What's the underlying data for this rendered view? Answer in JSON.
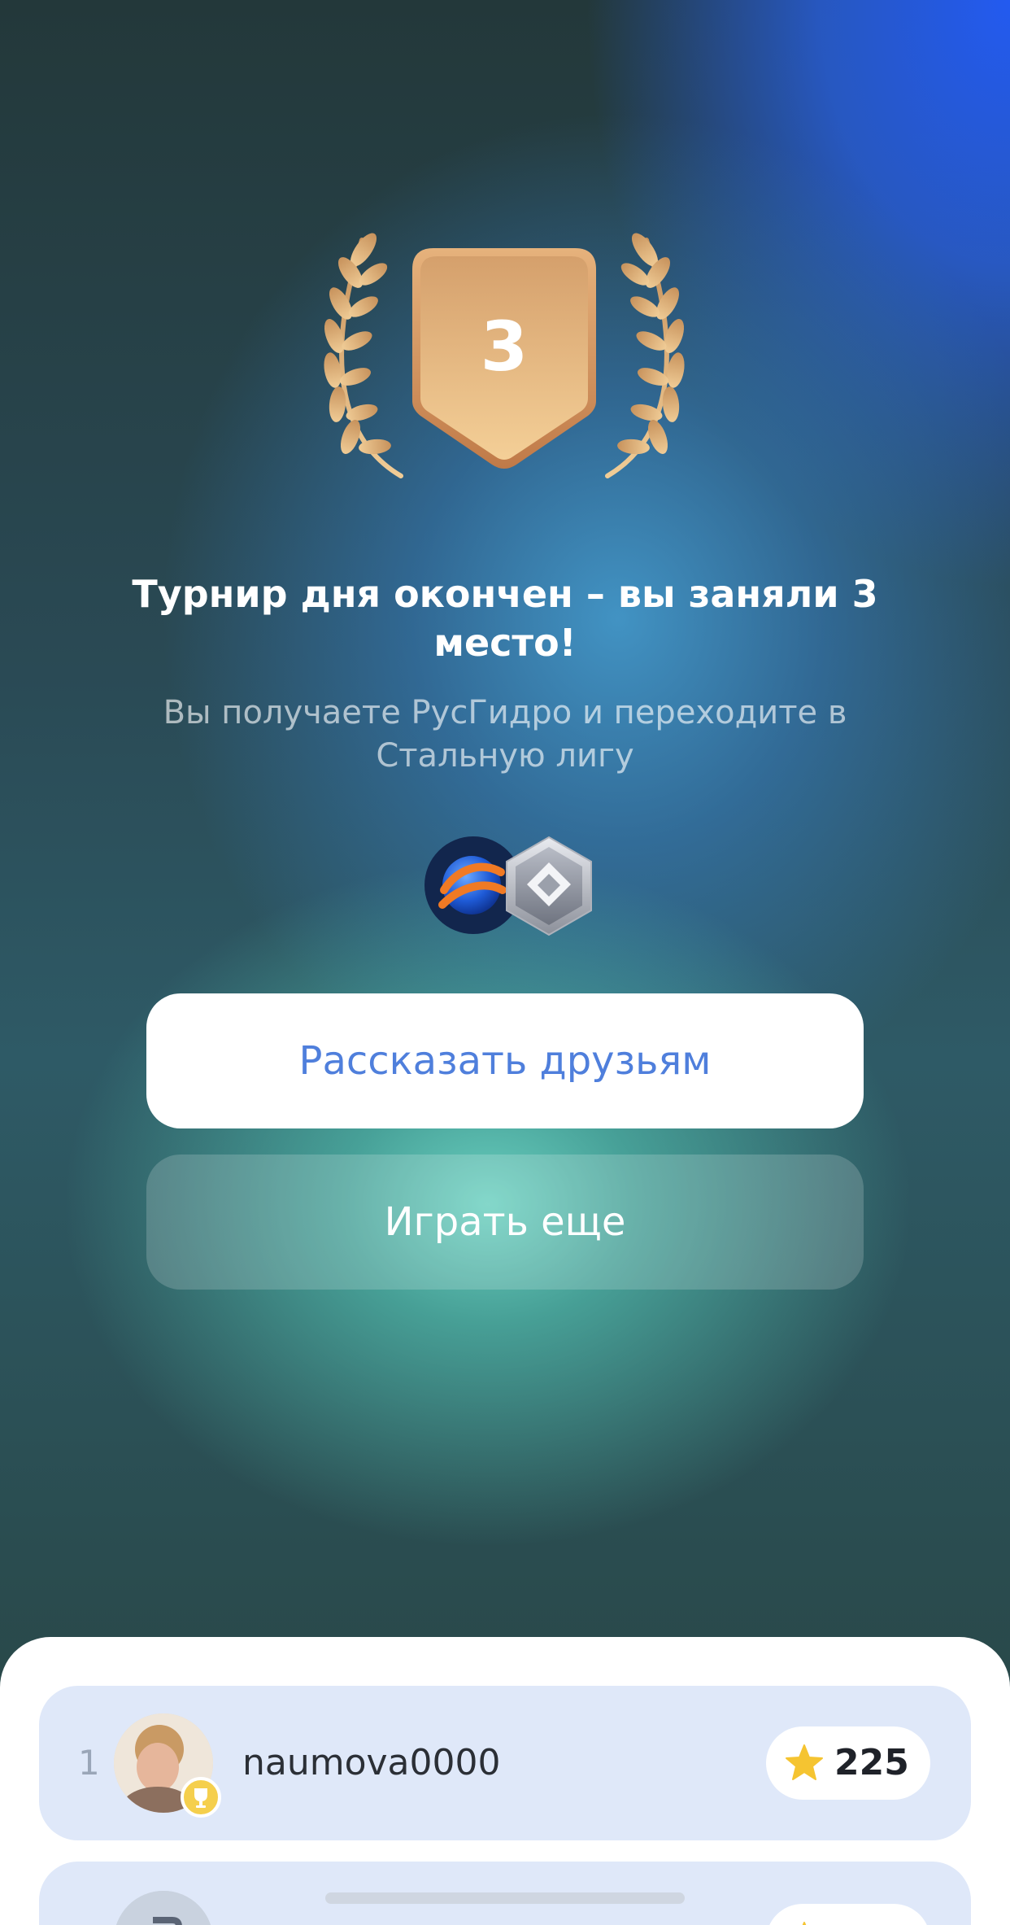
{
  "result": {
    "place_number": "3",
    "title": "Турнир дня окончен – вы заняли 3 место!",
    "subtitle": "Вы получаете РусГидро и переходите в Стальную лигу"
  },
  "rewards": {
    "brand_icon": "rushydro-logo-icon",
    "league_icon": "steel-league-icon"
  },
  "buttons": {
    "share_label": "Рассказать друзьям",
    "play_again_label": "Играть еще"
  },
  "leaderboard": {
    "rows": [
      {
        "rank": "1",
        "username": "naumova0000",
        "score": "225",
        "avatar_badge": "trophy-icon"
      }
    ]
  },
  "colors": {
    "accent_blue": "#4f7fdc",
    "bronze": "#d9a26a",
    "row_bg": "#dfe8f9",
    "star": "#f5c431"
  }
}
